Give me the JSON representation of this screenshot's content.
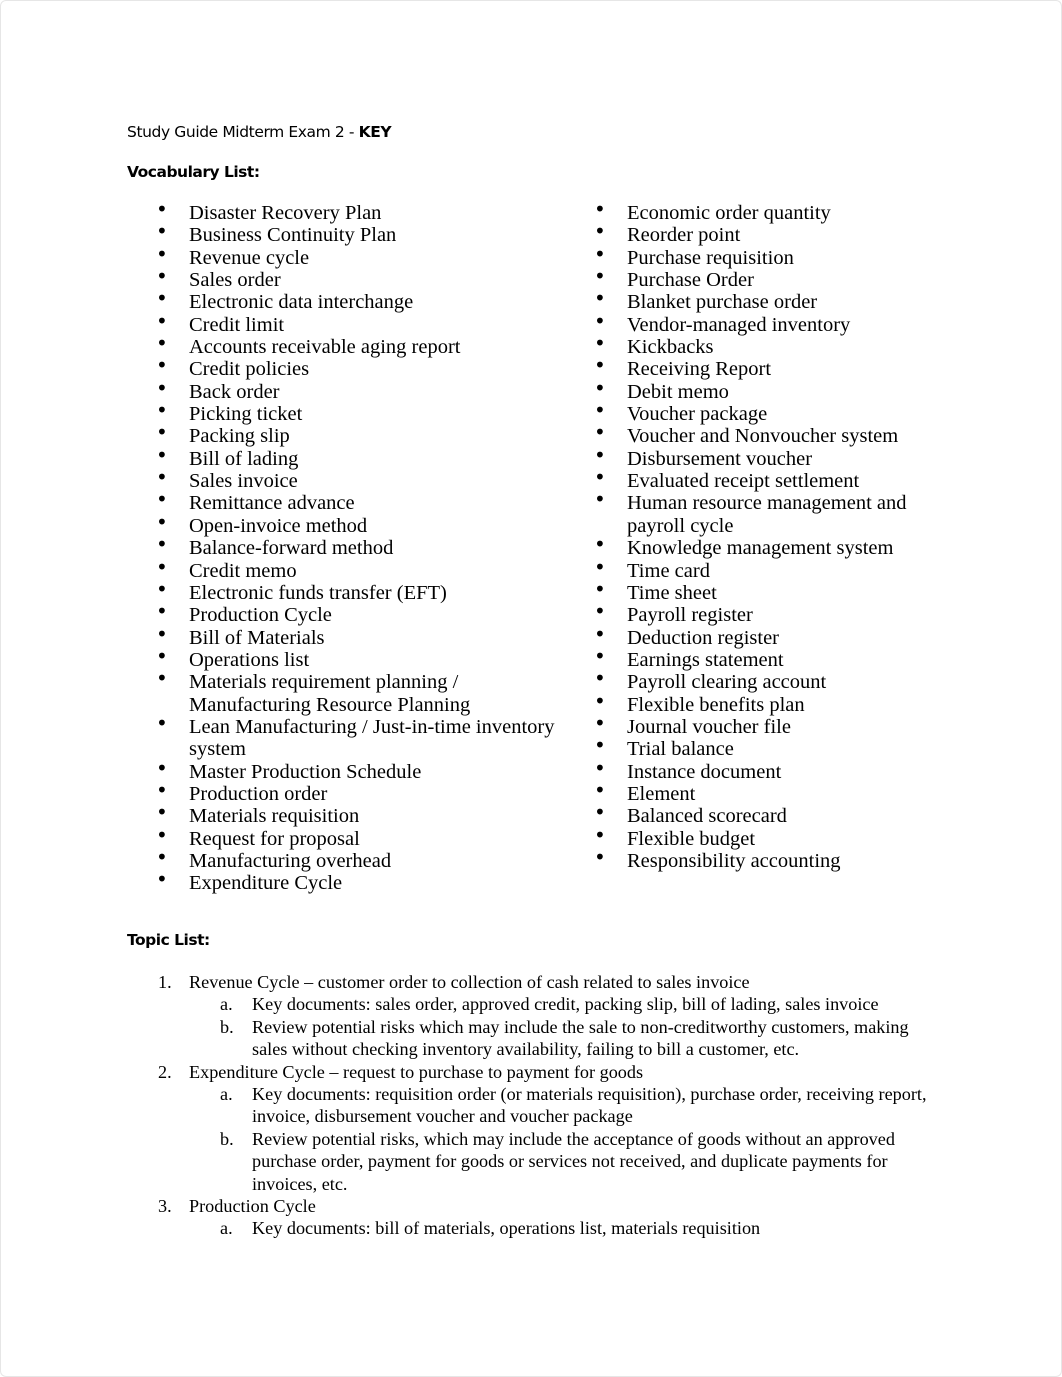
{
  "document": {
    "title": "Study Guide Midterm Exam 2 - ",
    "title_emphasis": "KEY",
    "vocabulary_heading": "Vocabulary List:",
    "bullet_glyph": "•",
    "vocabulary_left": [
      "Disaster Recovery Plan",
      "Business Continuity Plan",
      "Revenue cycle",
      "Sales order",
      "Electronic data interchange",
      "Credit limit",
      "Accounts receivable aging report",
      "Credit policies",
      "Back order",
      "Picking ticket",
      "Packing slip",
      "Bill of lading",
      "Sales invoice",
      "Remittance advance",
      "Open-invoice method",
      "Balance-forward method",
      "Credit memo",
      "Electronic funds transfer (EFT)",
      "Production Cycle",
      "Bill of Materials",
      "Operations list",
      "Materials requirement planning / Manufacturing Resource Planning",
      "Lean Manufacturing / Just-in-time inventory system",
      "Master Production Schedule",
      "Production order",
      "Materials requisition",
      "Request for proposal",
      "Manufacturing overhead",
      "Expenditure Cycle"
    ],
    "vocabulary_right": [
      "Economic order quantity",
      "Reorder point",
      "Purchase requisition",
      "Purchase Order",
      "Blanket purchase order",
      "Vendor-managed inventory",
      "Kickbacks",
      "Receiving Report",
      "Debit memo",
      "Voucher package",
      "Voucher and Nonvoucher system",
      "Disbursement voucher",
      "Evaluated receipt settlement",
      "Human resource management and payroll cycle",
      "Knowledge management system",
      "Time card",
      "Time sheet",
      "Payroll register",
      "Deduction register",
      "Earnings statement",
      "Payroll clearing account",
      "Flexible benefits plan",
      "Journal voucher file",
      "Trial balance",
      "Instance document",
      "Element",
      "Balanced scorecard",
      "Flexible budget",
      "Responsibility accounting"
    ],
    "topic_heading": "Topic List:",
    "topics": [
      {
        "number": "1.",
        "text": "Revenue Cycle – customer order to collection of cash related to sales invoice",
        "subitems": [
          {
            "letter": "a.",
            "text": "Key documents: sales order, approved credit, packing slip, bill of lading, sales invoice"
          },
          {
            "letter": "b.",
            "text": "Review potential risks which may include the sale to non-creditworthy customers, making sales without checking inventory availability, failing to bill a customer, etc."
          }
        ]
      },
      {
        "number": "2.",
        "text": "Expenditure Cycle – request to purchase to payment for goods",
        "subitems": [
          {
            "letter": "a.",
            "text": "Key documents: requisition order (or materials requisition), purchase order, receiving report, invoice, disbursement voucher and voucher package"
          },
          {
            "letter": "b.",
            "text": "Review potential risks, which may include the acceptance of goods without an approved purchase order, payment for goods or services not received, and duplicate payments for invoices, etc."
          }
        ]
      },
      {
        "number": "3.",
        "text": "Production Cycle",
        "subitems": [
          {
            "letter": "a.",
            "text": "Key documents: bill of materials, operations list, materials requisition"
          }
        ]
      }
    ]
  }
}
